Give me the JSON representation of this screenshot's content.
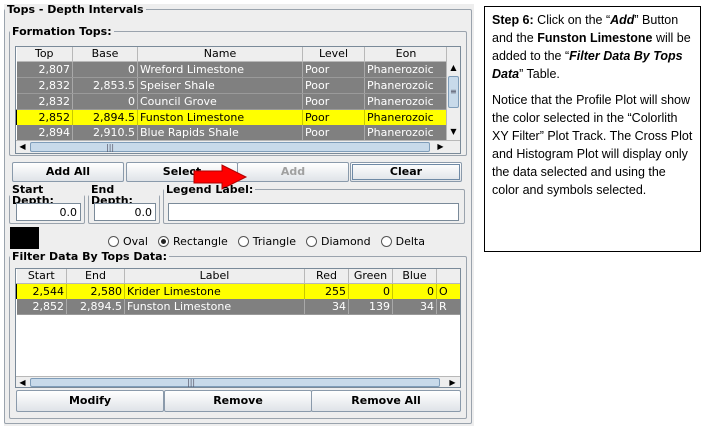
{
  "window": {
    "group_title": "Tops - Depth Intervals"
  },
  "formation_tops": {
    "title": "Formation Tops:",
    "columns": [
      "Top",
      "Base",
      "Name",
      "Level",
      "Eon"
    ],
    "rows": [
      {
        "top": "2,807",
        "base": "0",
        "name": "Wreford Limestone",
        "level": "Poor",
        "eon": "Phanerozoic",
        "selected": false
      },
      {
        "top": "2,832",
        "base": "2,853.5",
        "name": "Speiser Shale",
        "level": "Poor",
        "eon": "Phanerozoic",
        "selected": false
      },
      {
        "top": "2,832",
        "base": "0",
        "name": "Council Grove",
        "level": "Poor",
        "eon": "Phanerozoic",
        "selected": false
      },
      {
        "top": "2,852",
        "base": "2,894.5",
        "name": "Funston Limestone",
        "level": "Poor",
        "eon": "Phanerozoic",
        "selected": true
      },
      {
        "top": "2,894",
        "base": "2,910.5",
        "name": "Blue Rapids Shale",
        "level": "Poor",
        "eon": "Phanerozoic",
        "selected": false
      }
    ]
  },
  "buttons": {
    "add_all": "Add All",
    "select": "Select",
    "add": "Add",
    "clear": "Clear",
    "modify": "Modify",
    "remove": "Remove",
    "remove_all": "Remove All"
  },
  "start_depth": {
    "label": "Start Depth:",
    "value": "0.0"
  },
  "end_depth": {
    "label": "End Depth:",
    "value": "0.0"
  },
  "legend_label": {
    "label": "Legend Label:",
    "value": ""
  },
  "selected_color": "#000000",
  "highlight_color": "#ffff00",
  "arrow_color": "#ff0000",
  "symbols": {
    "options": [
      "Oval",
      "Rectangle",
      "Triangle",
      "Diamond",
      "Delta"
    ],
    "selected": "Rectangle"
  },
  "filter_data": {
    "title": "Filter Data By Tops Data:",
    "columns": [
      "Start",
      "End",
      "Label",
      "Red",
      "Green",
      "Blue"
    ],
    "rows": [
      {
        "start": "2,544",
        "end": "2,580",
        "label": "Krider Limestone",
        "red": "255",
        "green": "0",
        "blue": "0",
        "extra": "O",
        "selected": true
      },
      {
        "start": "2,852",
        "end": "2,894.5",
        "label": "Funston Limestone",
        "red": "34",
        "green": "139",
        "blue": "34",
        "extra": "R",
        "selected": false
      }
    ]
  },
  "instructions": {
    "step_label": "Step 6:",
    "t1": " Click on the “",
    "add_word": "Add",
    "t2": "” Button and the ",
    "funston": "Funston Limestone",
    "t3": " will be added to the ",
    "q_open": "“",
    "table_name": "Filter Data By Tops Data",
    "q_close": "”",
    "t4": " Table.",
    "p2": "Notice that the Profile Plot will show the color selected in the “Colorlith XY Filter” Plot Track. The Cross Plot and Histogram Plot will display only the data selected and using the color and symbols selected."
  }
}
